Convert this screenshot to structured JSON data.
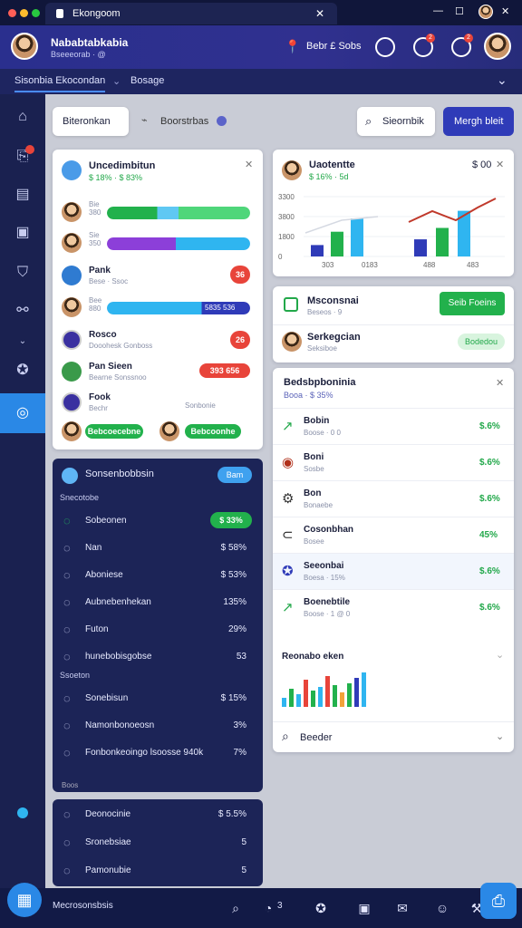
{
  "window": {
    "tab_title": "Ekongoom",
    "close": "✕",
    "minimize": "—",
    "maximize": "☐"
  },
  "header": {
    "user_name": "Nababtabkabia",
    "user_sub": "Bseeeorab · @",
    "action_label": "Bebr £ Sobs",
    "badge1": "2",
    "badge2": "2"
  },
  "subnav": {
    "item1": "Sisonbia Ekocondan",
    "item2": "Bosage"
  },
  "toolbar": {
    "tab_label": "Biteronkan",
    "tab2_label": "Boorstrbas",
    "search_label": "Sieornbik",
    "primary_button": "Mergh bleit"
  },
  "left_card": {
    "title": "Uncedimbitun",
    "sub": "$ 18% · $ 83%",
    "rows": [
      {
        "name": "",
        "sub": "Bie\n380",
        "fill_a": 0.5,
        "fill_b": 1.0
      },
      {
        "name": "",
        "sub": "Sie\n350",
        "fill_a": 0.48,
        "fill_b": 1.0
      },
      {
        "name": "Pank",
        "sub": "Bese · Ssoc",
        "tag": "36"
      },
      {
        "name": "",
        "sub": "Bee\n880",
        "tag": "5835 536"
      },
      {
        "name": "Rosco",
        "sub": "Dooohesk Gonboss",
        "tag": "26"
      },
      {
        "name": "Pan Sieen",
        "sub": "Bearne Sonssnoo",
        "tag": "393 656"
      },
      {
        "name": "Fook",
        "sub": "Bechr",
        "tag": "Sonbonie"
      }
    ],
    "foot1": "Bebcoecebne",
    "foot2": "Bebcoonhe"
  },
  "chart_card": {
    "title": "Uaotentte",
    "sub": "$ 16% · 5d",
    "corner": "$ 00",
    "close": "✕",
    "y_ticks": [
      "3300",
      "3800",
      "1800",
      "0"
    ],
    "x_ticks": [
      "303",
      "0183",
      "488",
      "483"
    ]
  },
  "promo1": {
    "title": "Msconsnai",
    "sub": "Beseos · 9",
    "button": "Seib Foeins"
  },
  "promo2": {
    "title": "Serkegcian",
    "sub": "Seksiboe",
    "tag": "Bodedou"
  },
  "right_list": {
    "title": "Bedsbpboninia",
    "sub": "Booa · $ 35%",
    "close": "✕",
    "rows": [
      {
        "name": "Bobin",
        "sub": "Boose · 0 0",
        "value": "$.6%"
      },
      {
        "name": "Boni",
        "sub": "Sosbe",
        "value": "$.6%"
      },
      {
        "name": "Bon",
        "sub": "Bonaebe",
        "value": "$.6%"
      },
      {
        "name": "Cosonbhan",
        "sub": "Bosee",
        "value": "45%"
      },
      {
        "name": "Seeonbai",
        "sub": "Boesa · 15%",
        "value": "$.6%"
      },
      {
        "name": "Boenebtile",
        "sub": "Boose · 1 @ 0",
        "value": "$.6%"
      }
    ],
    "bars_title": "Reonabo eken",
    "search_label": "Beeder"
  },
  "dark_card": {
    "header": "Sonsenbobbsin",
    "header_tag": "Bam",
    "section1": "Snecotobe",
    "items": [
      {
        "label": "Sobeonen",
        "value": "$ 33%"
      },
      {
        "label": "Nan",
        "value": "$ 58%"
      },
      {
        "label": "Aboniese",
        "value": "$ 53%"
      },
      {
        "label": "Aubnebenhekan",
        "value": "135%"
      },
      {
        "label": "Futon",
        "value": "29%"
      },
      {
        "label": "hunebobisgobse",
        "value": "53"
      }
    ],
    "section2": "Ssoeton",
    "items2": [
      {
        "label": "Sonebisun",
        "value": "$ 15%"
      },
      {
        "label": "Namonbonoeosn",
        "value": "3%"
      },
      {
        "label": "Fonbonkeoingo lsoosse 940k",
        "value": "7%"
      }
    ],
    "foot": "Boos"
  },
  "dark_card2": {
    "items": [
      {
        "label": "Deonocinie",
        "value": "$ 5.5%"
      },
      {
        "label": "Sronebsiae",
        "value": "5"
      },
      {
        "label": "Pamonubie",
        "value": "5"
      }
    ]
  },
  "dock": {
    "label": "Mecrosonsbsis",
    "count": "3"
  },
  "chart_data": {
    "type": "bar",
    "series": [
      {
        "values": [
          12,
          26,
          40
        ]
      },
      {
        "values": [
          18,
          30,
          48
        ]
      }
    ],
    "y_ticks": [
      "3300",
      "3800",
      "1800",
      "0"
    ],
    "x_ticks": [
      "303",
      "0183",
      "488",
      "483"
    ]
  },
  "colors": {
    "accent": "#2f3bb8",
    "green": "#22b14c",
    "cyan": "#2fb5f0",
    "purple": "#8c3fd9",
    "red": "#e8443a"
  }
}
